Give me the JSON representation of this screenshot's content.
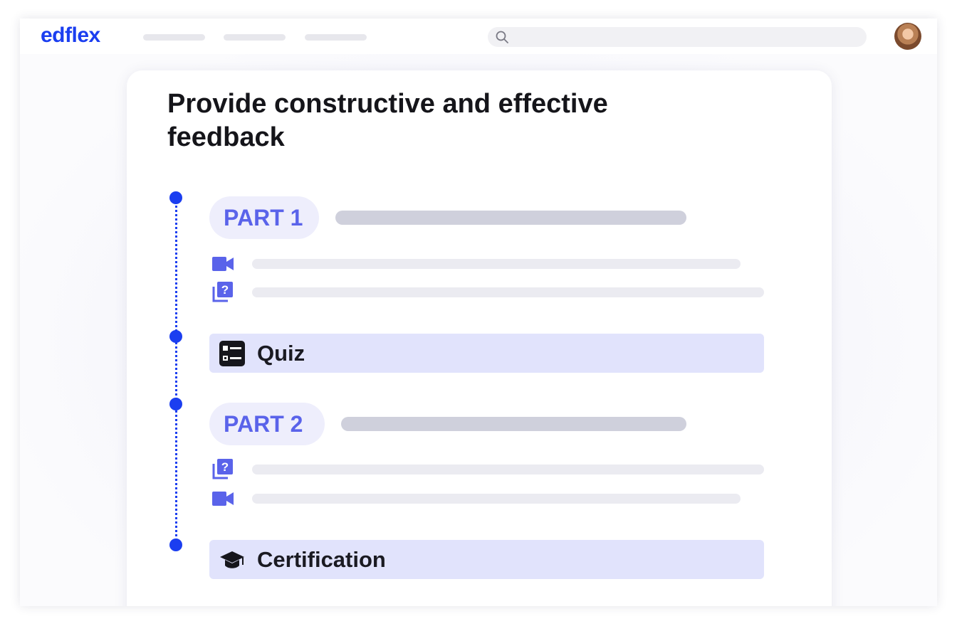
{
  "app": {
    "logo": "edflex",
    "accent_color": "#1b3ef0"
  },
  "header": {
    "nav_placeholders": [
      "nav-item",
      "nav-item",
      "nav-item"
    ],
    "search_icon": "search-icon",
    "avatar_icon": "user-avatar"
  },
  "course": {
    "title": "Provide constructive and effective feedback",
    "sections": [
      {
        "type": "part",
        "label": "PART 1",
        "items": [
          {
            "icon": "video-camera-icon"
          },
          {
            "icon": "question-cards-icon"
          }
        ]
      },
      {
        "type": "activity",
        "label": "Quiz",
        "icon": "quiz-list-icon"
      },
      {
        "type": "part",
        "label": "PART 2",
        "items": [
          {
            "icon": "question-cards-icon"
          },
          {
            "icon": "video-camera-icon"
          }
        ]
      },
      {
        "type": "activity",
        "label": "Certification",
        "icon": "graduation-cap-icon"
      }
    ]
  }
}
